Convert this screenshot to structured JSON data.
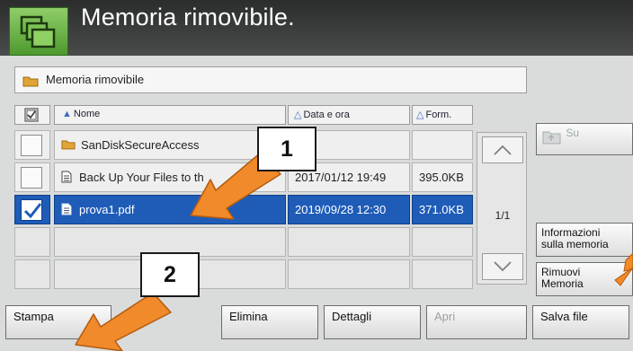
{
  "title": "Memoria rimovibile.",
  "path_label": "Memoria rimovibile",
  "columns": {
    "name": "Nome",
    "date": "Data e ora",
    "format": "Form."
  },
  "rows": [
    {
      "name": "SanDiskSecureAccess",
      "date": "",
      "size": "",
      "type": "folder",
      "selected": false
    },
    {
      "name": "Back Up Your Files to th",
      "date": "2017/01/12 19:49",
      "size": "395.0KB",
      "type": "file",
      "selected": false
    },
    {
      "name": "prova1.pdf",
      "date": "2019/09/28 12:30",
      "size": "371.0KB",
      "type": "file",
      "selected": true
    }
  ],
  "pager": {
    "page": "1/1"
  },
  "side_buttons": {
    "su": "Su",
    "info_line1": "Informazioni",
    "info_line2": "sulla memoria",
    "remove_line1": "Rimuovi",
    "remove_line2": "Memoria"
  },
  "bottom_buttons": {
    "stampa": "Stampa",
    "elimina": "Elimina",
    "dettagli": "Dettagli",
    "apri": "Apri",
    "salva": "Salva file"
  },
  "annotations": {
    "callout1": "1",
    "callout2": "2"
  },
  "colors": {
    "selection": "#1f5cb8",
    "arrow": "#f08a2a",
    "icon_green": "#6ab344"
  }
}
